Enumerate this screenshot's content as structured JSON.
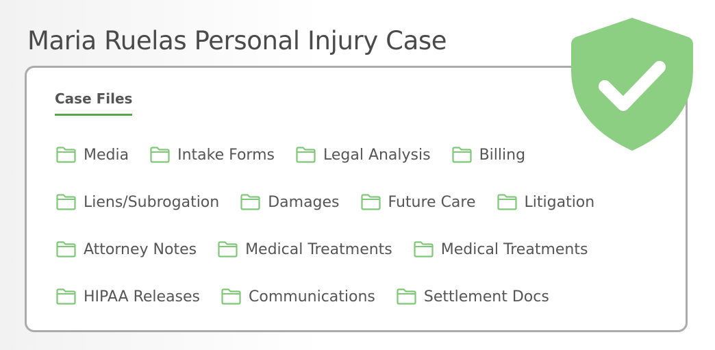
{
  "case": {
    "title": "Maria Ruelas Personal Injury Case"
  },
  "tabs": [
    {
      "label": "Case Files",
      "active": true
    }
  ],
  "folders": {
    "row1": [
      "Media",
      "Intake Forms",
      "Legal Analysis",
      "Billing"
    ],
    "row2": [
      "Liens/Subrogation",
      "Damages",
      "Future Care",
      "Litigation"
    ],
    "row3": [
      "Attorney Notes",
      "Medical Treatments",
      "Medical Treatments"
    ],
    "row4": [
      "HIPAA Releases",
      "Communications",
      "Settlement Docs"
    ]
  },
  "icons": {
    "folder": "folder-icon",
    "badge": "shield-check-icon"
  },
  "colors": {
    "accent": "#5aa44f",
    "folder_stroke": "#7fc878",
    "shield": "#8ccf82",
    "text": "#555555",
    "title": "#4a4a4a"
  }
}
